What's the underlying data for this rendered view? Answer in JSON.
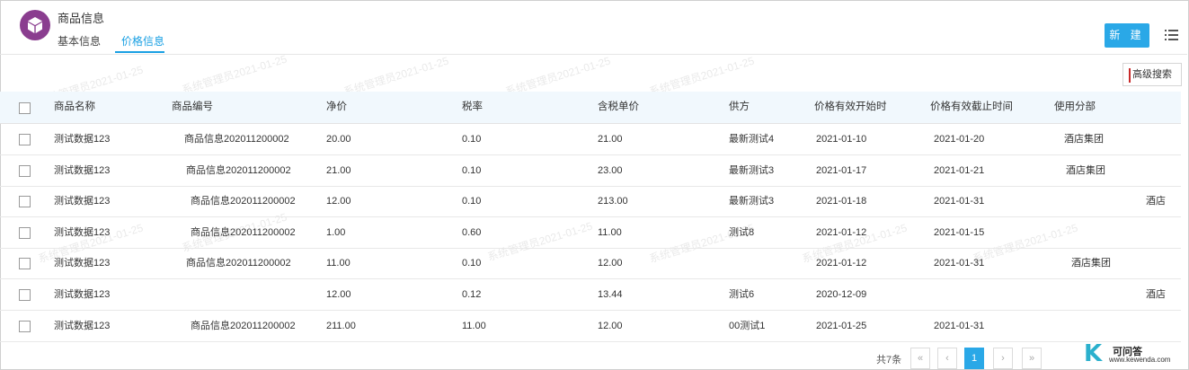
{
  "header": {
    "title": "商品信息",
    "tabs": [
      {
        "label": "基本信息",
        "active": false
      },
      {
        "label": "价格信息",
        "active": true
      }
    ],
    "new_button": "新 建",
    "advanced_search": "高级搜索"
  },
  "watermark": "系统管理员2021-01-25",
  "colors": {
    "accent": "#2aa8e7",
    "avatar": "#8a3d8f",
    "header_bg": "#f1f8fd"
  },
  "table": {
    "columns": [
      "商品名称",
      "商品编号",
      "净价",
      "税率",
      "含税单价",
      "供方",
      "价格有效开始时",
      "价格有效截止时间",
      "使用分部"
    ],
    "rows": [
      [
        "测试数据123",
        "商品信息202011200002",
        "20.00",
        "0.10",
        "21.00",
        "最新测试4",
        "2021-01-10",
        "2021-01-20",
        "酒店集团"
      ],
      [
        "测试数据123",
        "商品信息202011200002",
        "21.00",
        "0.10",
        "23.00",
        "最新测试3",
        "2021-01-17",
        "2021-01-21",
        "酒店集团"
      ],
      [
        "测试数据123",
        "商品信息202011200002",
        "12.00",
        "0.10",
        "213.00",
        "最新测试3",
        "2021-01-18",
        "2021-01-31",
        "酒店"
      ],
      [
        "测试数据123",
        "商品信息202011200002",
        "1.00",
        "0.60",
        "11.00",
        "测试8",
        "2021-01-12",
        "2021-01-15",
        ""
      ],
      [
        "测试数据123",
        "商品信息202011200002",
        "11.00",
        "0.10",
        "12.00",
        "",
        "2021-01-12",
        "2021-01-31",
        "酒店集团"
      ],
      [
        "测试数据123",
        "",
        "12.00",
        "0.12",
        "13.44",
        "测试6",
        "2020-12-09",
        "",
        "酒店"
      ],
      [
        "测试数据123",
        "商品信息202011200002",
        "211.00",
        "11.00",
        "12.00",
        "00测试1",
        "2021-01-25",
        "2021-01-31",
        ""
      ]
    ]
  },
  "pagination": {
    "total": "共7条",
    "first": "«",
    "prev": "‹",
    "current": "1",
    "next": "›",
    "last": "»"
  },
  "logo": {
    "letter": "K",
    "name": "可问答",
    "url": "www.kewenda.com"
  }
}
